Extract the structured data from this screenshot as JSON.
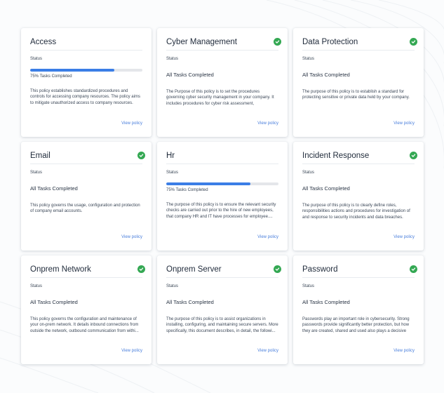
{
  "cards": [
    {
      "title": "Access",
      "status_label": "Status",
      "completed": false,
      "progress": 0.75,
      "progress_text": "75% Tasks Completed",
      "description": "This policy establishes standardized procedures and controls for accessing company resources. The policy aims to mitigate unauthorized access to company resources.",
      "link": "View policy"
    },
    {
      "title": "Cyber Management",
      "status_label": "Status",
      "completed": true,
      "status_text": "All Tasks Completed",
      "description": "The Purpose of this policy is to set the procedures governing cyber security management in your company. It includes procedures for cyber risk assessment, management, ...",
      "link": "View policy"
    },
    {
      "title": "Data Protection",
      "status_label": "Status",
      "completed": true,
      "status_text": "All Tasks Completed",
      "description": "The purpose of this policy is to establish a standard for protecting sensitive or private data held by your company.",
      "link": "View policy"
    },
    {
      "title": "Email",
      "status_label": "Status",
      "completed": true,
      "status_text": "All Tasks Completed",
      "description": "This policy governs the usage, configuration and protection of company email accounts.",
      "link": "View policy"
    },
    {
      "title": "Hr",
      "status_label": "Status",
      "completed": false,
      "progress": 0.75,
      "progress_text": "75% Tasks Completed",
      "description": "The purpose of this policy is to ensure the relevant security checks are carried out prior to the hire of new employees, that company HR and IT have processes for employee....",
      "link": "View policy"
    },
    {
      "title": "Incident Response",
      "status_label": "Status",
      "completed": true,
      "status_text": "All Tasks Completed",
      "description": "The purpose of this policy is to clearly define roles, responsibilities actions and procedures for investigation of and response to security incidents and data breaches.",
      "link": "View policy"
    },
    {
      "title": "Onprem Network",
      "status_label": "Status",
      "completed": true,
      "status_text": "All Tasks Completed",
      "description": "This policy governs the configuration and maintenance of your on-prem network. It details inbound connections from outside the network, outbound communication from withi...",
      "link": "View policy"
    },
    {
      "title": "Onprem Server",
      "status_label": "Status",
      "completed": true,
      "status_text": "All Tasks Completed",
      "description": "The purpose of this policy is to assist organizations in installing, configuring, and maintaining secure servers. More specifically, this document describes, in detail, the followi...",
      "link": "View policy"
    },
    {
      "title": "Password",
      "status_label": "Status",
      "completed": true,
      "status_text": "All Tasks Completed",
      "description": "Passwords play an important role in cybersecurity. Strong passwords provide significantly better protection, but how they are created, shared and used also plays a decisive rol...",
      "link": "View policy"
    }
  ],
  "colors": {
    "accent": "#3b7ee6",
    "success": "#34a853",
    "link": "#4a7fdc"
  },
  "icons": {
    "completed": "check-circle-icon"
  }
}
